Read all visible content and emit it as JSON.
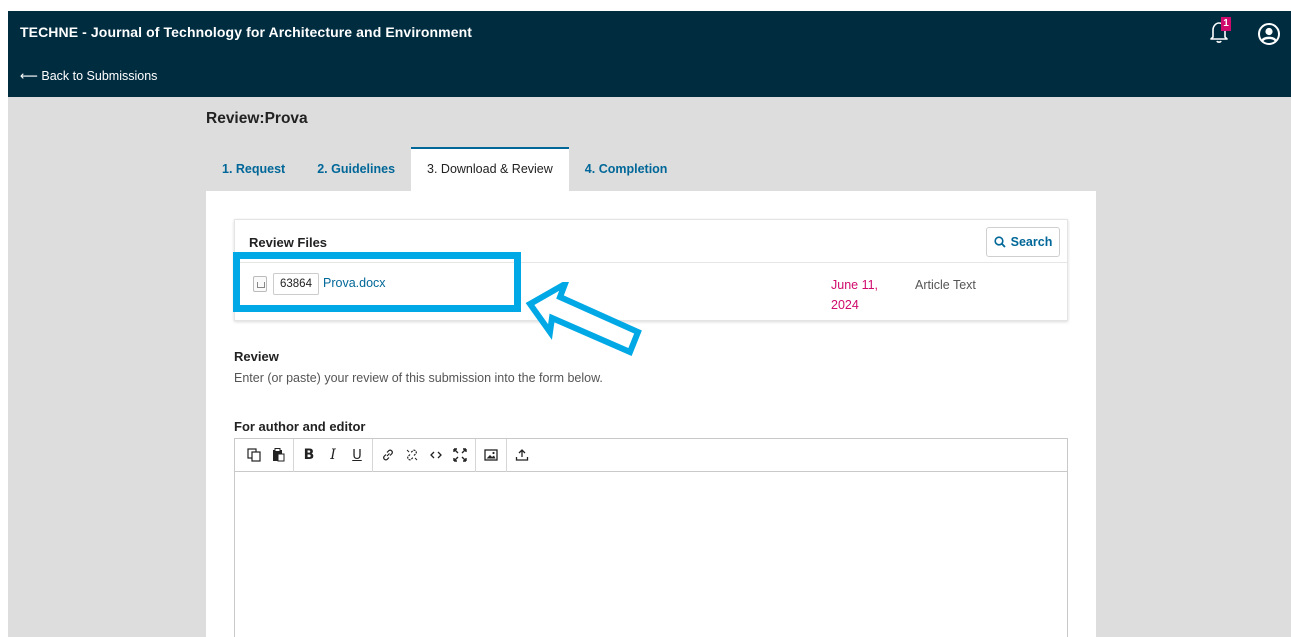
{
  "header": {
    "site_title": "TECHNE - Journal of Technology for Architecture and Environment",
    "back_link": "⟵ Back to Submissions",
    "notification_count": "1"
  },
  "page": {
    "title": "Review:Prova"
  },
  "tabs": [
    {
      "label": "1. Request",
      "active": false
    },
    {
      "label": "2. Guidelines",
      "active": false
    },
    {
      "label": "3. Download & Review",
      "active": true
    },
    {
      "label": "4. Completion",
      "active": false
    }
  ],
  "review_files": {
    "title": "Review Files",
    "search_label": "Search",
    "files": [
      {
        "id": "63864",
        "name": "Prova.docx",
        "date_line1": "June 11,",
        "date_line2": "2024",
        "genre": "Article Text"
      }
    ]
  },
  "review": {
    "label": "Review",
    "description": "Enter (or paste) your review of this submission into the form below."
  },
  "editor": {
    "label": "For author and editor",
    "toolbar_icons": [
      "copy-icon",
      "paste-icon",
      "bold-icon",
      "italic-icon",
      "underline-icon",
      "link-icon",
      "unlink-icon",
      "code-icon",
      "fullscreen-icon",
      "image-icon",
      "upload-icon"
    ],
    "content": ""
  },
  "colors": {
    "topbar": "#002c40",
    "link": "#006798",
    "date": "#d00a6c",
    "highlight": "#00a9e6"
  }
}
